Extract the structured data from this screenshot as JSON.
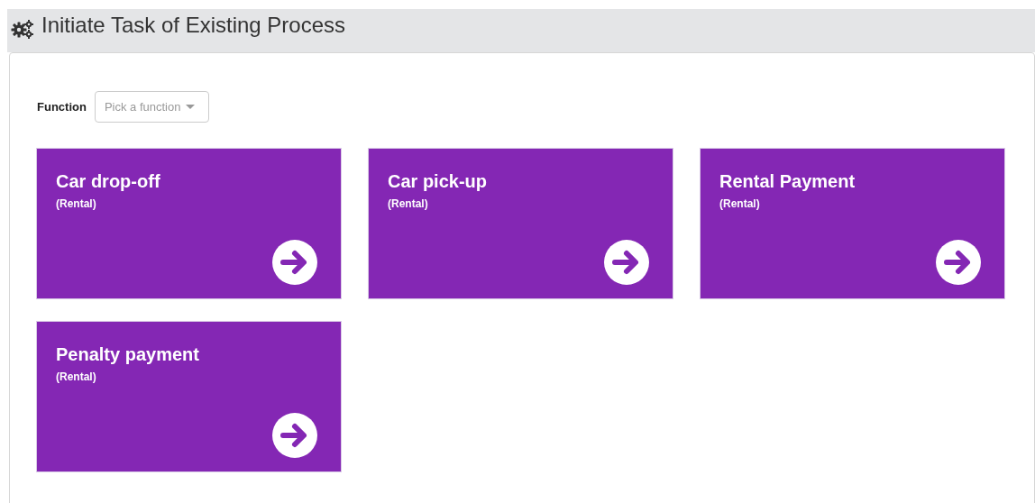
{
  "header": {
    "title": "Initiate Task of Existing Process"
  },
  "filter": {
    "label": "Function",
    "placeholder": "Pick a function"
  },
  "tasks": [
    {
      "title": "Car drop-off",
      "subtitle": "(Rental)"
    },
    {
      "title": "Car pick-up",
      "subtitle": "(Rental)"
    },
    {
      "title": "Rental Payment",
      "subtitle": "(Rental)"
    },
    {
      "title": "Penalty payment",
      "subtitle": "(Rental)"
    }
  ]
}
